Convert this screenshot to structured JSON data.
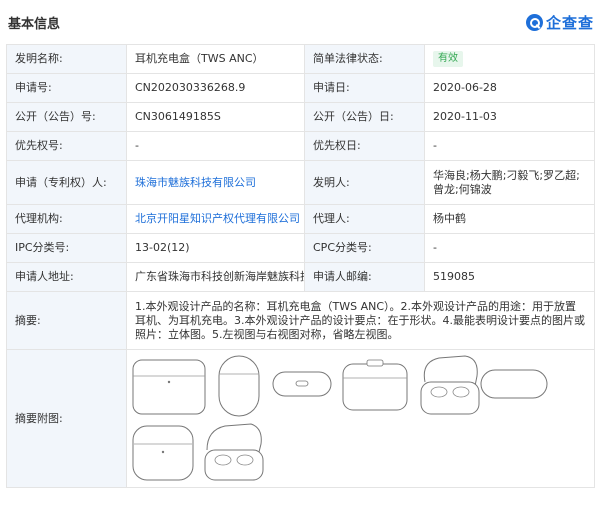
{
  "section": {
    "title": "基本信息",
    "logo_text": "企查查"
  },
  "rows": {
    "name_label": "发明名称:",
    "name_value": "耳机充电盒（TWS ANC）",
    "status_label": "简单法律状态:",
    "status_value": "有效",
    "appno_label": "申请号:",
    "appno_value": "CN202030336268.9",
    "appdate_label": "申请日:",
    "appdate_value": "2020-06-28",
    "pubno_label": "公开（公告）号:",
    "pubno_value": "CN306149185S",
    "pubdate_label": "公开（公告）日:",
    "pubdate_value": "2020-11-03",
    "priority_label": "优先权号:",
    "priority_value": "-",
    "prioritydate_label": "优先权日:",
    "prioritydate_value": "-",
    "applicant_label": "申请（专利权）人:",
    "applicant_value": "珠海市魅族科技有限公司",
    "inventor_label": "发明人:",
    "inventor_value": "华海良;杨大鹏;刁毅飞;罗乙超;曾龙;何锦波",
    "agency_label": "代理机构:",
    "agency_value": "北京开阳星知识产权代理有限公司",
    "agent_label": "代理人:",
    "agent_value": "杨中鹤",
    "ipc_label": "IPC分类号:",
    "ipc_value": "13-02(12)",
    "cpc_label": "CPC分类号:",
    "cpc_value": "-",
    "address_label": "申请人地址:",
    "address_value": "广东省珠海市科技创新海岸魅族科技楼",
    "postcode_label": "申请人邮编:",
    "postcode_value": "519085",
    "abstract_label": "摘要:",
    "abstract_value": "1.本外观设计产品的名称：耳机充电盒（TWS ANC）。2.本外观设计产品的用途：用于放置耳机、为耳机充电。3.本外观设计产品的设计要点：在于形状。4.最能表明设计要点的图片或照片：立体图。5.左视图与右视图对称，省略左视图。",
    "figures_label": "摘要附图:"
  },
  "colors": {
    "label_bg": "#f2f6fb",
    "link": "#1e6fd9",
    "badge_bg": "#e7f6ec",
    "badge_text": "#34a853",
    "border": "#e4e4e4"
  }
}
